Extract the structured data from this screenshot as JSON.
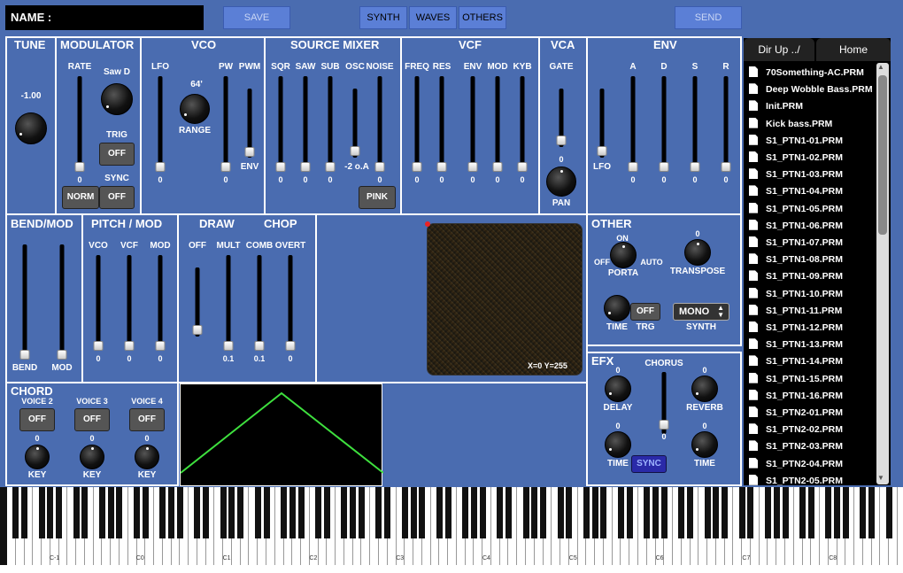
{
  "header": {
    "name_label": "NAME :",
    "save": "SAVE",
    "synth": "SYNTH",
    "waves": "WAVES",
    "others": "OTHERS",
    "send": "SEND"
  },
  "tune": {
    "title": "TUNE",
    "value": "-1.00"
  },
  "modulator": {
    "title": "MODULATOR",
    "rate": "RATE",
    "wave": "Saw D",
    "trig": "TRIG",
    "trig_state": "OFF",
    "sync": "SYNC",
    "sync_state": "OFF",
    "norm": "NORM",
    "rate_val": "0"
  },
  "vco": {
    "title": "VCO",
    "lfo": "LFO",
    "pw": "PW",
    "pwm": "PWM",
    "range_val": "64'",
    "range": "RANGE",
    "env": "ENV",
    "lfo_val": "0",
    "pw_val": "0"
  },
  "mixer": {
    "title": "SOURCE MIXER",
    "sqr": "SQR",
    "saw": "SAW",
    "sub": "SUB",
    "osc": "OSC",
    "noise": "NOISE",
    "v_sqr": "0",
    "v_saw": "0",
    "v_sub": "0",
    "v_osc": "-2 o.A",
    "v_noise": "0",
    "pink": "PINK"
  },
  "vcf": {
    "title": "VCF",
    "freq": "FREQ",
    "res": "RES",
    "env": "ENV",
    "mod": "MOD",
    "kyb": "KYB",
    "vals": [
      "0",
      "0",
      "0",
      "0",
      "0"
    ]
  },
  "vca": {
    "title": "VCA",
    "gate": "GATE",
    "pan": "PAN",
    "pan_val": "0"
  },
  "env": {
    "title": "ENV",
    "a": "A",
    "d": "D",
    "s": "S",
    "r": "R",
    "lfo": "LFO",
    "vals": [
      "0",
      "0",
      "0",
      "0"
    ]
  },
  "bendmod": {
    "title": "BEND/MOD",
    "bend": "BEND",
    "mod": "MOD"
  },
  "pitchmod": {
    "title": "PITCH / MOD",
    "vco": "VCO",
    "vcf": "VCF",
    "mod": "MOD",
    "vals": [
      "0",
      "0",
      "0"
    ]
  },
  "drawchop": {
    "draw": "DRAW",
    "chop": "CHOP",
    "off": "OFF",
    "mult": "MULT",
    "comb": "COMB",
    "overt": "OVERT",
    "vals": [
      "0.1",
      "0.1",
      "0"
    ]
  },
  "xy": {
    "readout": "X=0 Y=255"
  },
  "other": {
    "title": "OTHER",
    "on": "ON",
    "off": "OFF",
    "auto": "AUTO",
    "porta": "PORTA",
    "transpose": "TRANSPOSE",
    "transpose_val": "0",
    "time": "TIME",
    "trg": "TRG",
    "trg_state": "OFF",
    "mono": "MONO",
    "synth": "SYNTH"
  },
  "efx": {
    "title": "EFX",
    "chorus": "CHORUS",
    "delay": "DELAY",
    "reverb": "REVERB",
    "time": "TIME",
    "sync": "SYNC",
    "vals": {
      "delay": "0",
      "reverb": "0",
      "chorus": "0",
      "time1": "0",
      "time2": "0"
    }
  },
  "chord": {
    "title": "CHORD",
    "v2": "VOICE 2",
    "v3": "VOICE 3",
    "v4": "VOICE 4",
    "off": "OFF",
    "key": "KEY",
    "val": "0"
  },
  "files": {
    "dirup": "Dir Up ../",
    "home": "Home",
    "items": [
      "70Something-AC.PRM",
      "Deep Wobble Bass.PRM",
      "Init.PRM",
      "Kick bass.PRM",
      "S1_PTN1-01.PRM",
      "S1_PTN1-02.PRM",
      "S1_PTN1-03.PRM",
      "S1_PTN1-04.PRM",
      "S1_PTN1-05.PRM",
      "S1_PTN1-06.PRM",
      "S1_PTN1-07.PRM",
      "S1_PTN1-08.PRM",
      "S1_PTN1-09.PRM",
      "S1_PTN1-10.PRM",
      "S1_PTN1-11.PRM",
      "S1_PTN1-12.PRM",
      "S1_PTN1-13.PRM",
      "S1_PTN1-14.PRM",
      "S1_PTN1-15.PRM",
      "S1_PTN1-16.PRM",
      "S1_PTN2-01.PRM",
      "S1_PTN2-02.PRM",
      "S1_PTN2-03.PRM",
      "S1_PTN2-04.PRM",
      "S1_PTN2-05.PRM"
    ]
  },
  "keyboard": {
    "octaves": [
      "C-1",
      "C0",
      "C1",
      "C2",
      "C3",
      "C4",
      "C5",
      "C6",
      "C7",
      "C8"
    ]
  }
}
